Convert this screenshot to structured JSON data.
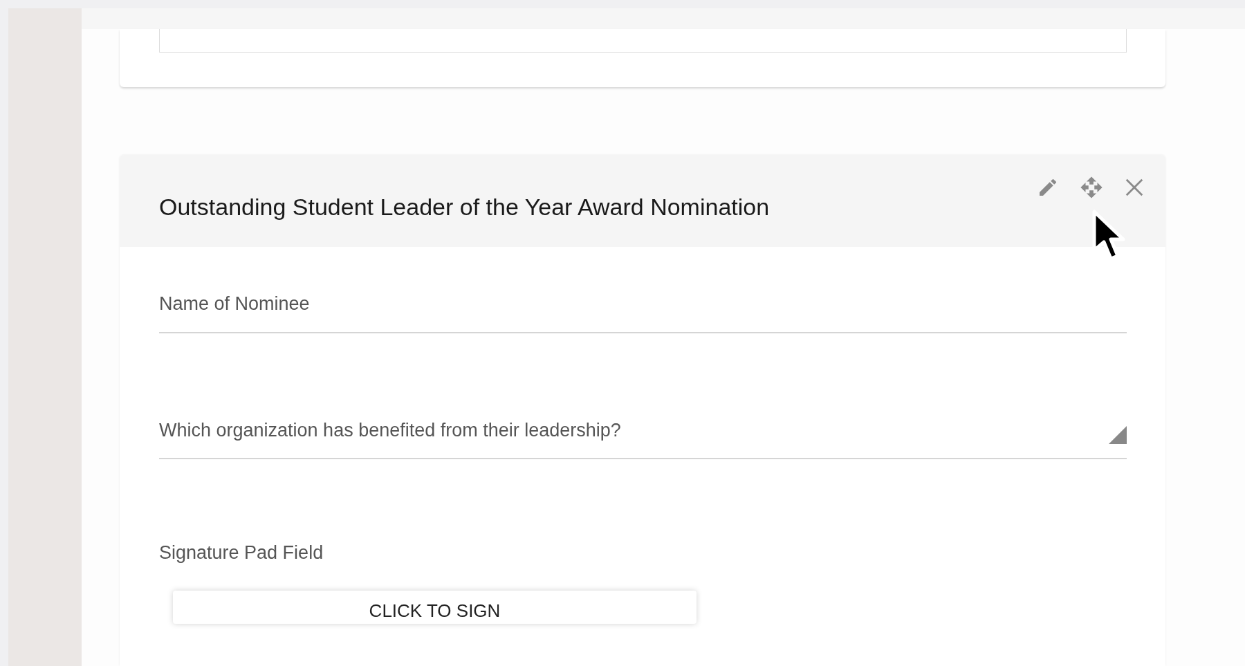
{
  "form": {
    "title": "Outstanding Student Leader of the Year Award Nomination",
    "fields": [
      {
        "kind": "text",
        "label": "Name of Nominee"
      },
      {
        "kind": "textarea",
        "label": "Which organization has benefited from their leadership?"
      },
      {
        "kind": "signature",
        "label": "Signature Pad Field",
        "button": "CLICK TO SIGN"
      }
    ]
  }
}
